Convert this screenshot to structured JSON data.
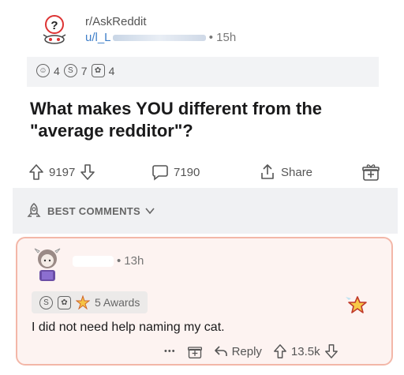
{
  "post": {
    "subreddit": "r/AskReddit",
    "user_prefix": "u/l_L",
    "time_sep": "•",
    "time": "15h",
    "awards": [
      {
        "icon": "wholesome-award-icon",
        "count": "4"
      },
      {
        "icon": "silver-award-icon",
        "count": "7"
      },
      {
        "icon": "helpful-award-icon",
        "count": "4"
      }
    ],
    "title": "What makes YOU different from the \"average redditor\"?",
    "upvotes": "9197",
    "comments": "7190",
    "share_label": "Share"
  },
  "sort": {
    "label": "BEST COMMENTS"
  },
  "comment": {
    "time": "13h",
    "awards_label": "5 Awards",
    "body": "I did not need help naming my cat.",
    "more": "•••",
    "reply_label": "Reply",
    "score": "13.5k"
  },
  "colors": {
    "accent": "#3f7fc9",
    "card_bg": "#fdf3f1",
    "card_border": "#f3b7a8"
  }
}
